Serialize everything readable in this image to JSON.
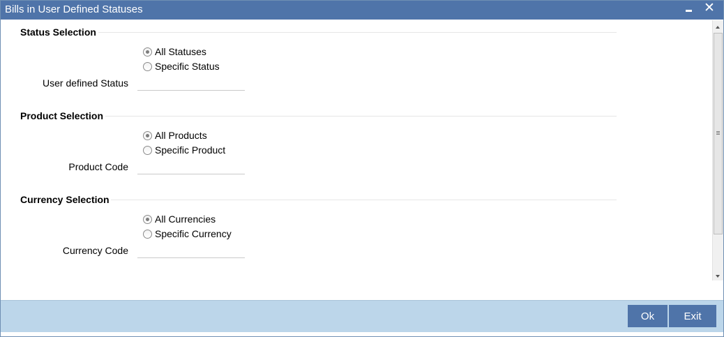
{
  "window": {
    "title": "Bills in User Defined Statuses",
    "minimize_icon": "minimize-icon",
    "close_icon": "close-icon",
    "close_glyph": "✕"
  },
  "status_section": {
    "title": "Status Selection",
    "options": [
      {
        "label": "All Statuses",
        "checked": true
      },
      {
        "label": "Specific Status",
        "checked": false
      }
    ],
    "field_label": "User defined Status",
    "field_value": ""
  },
  "product_section": {
    "title": "Product Selection",
    "options": [
      {
        "label": "All Products",
        "checked": true
      },
      {
        "label": "Specific Product",
        "checked": false
      }
    ],
    "field_label": "Product Code",
    "field_value": ""
  },
  "currency_section": {
    "title": "Currency Selection",
    "options": [
      {
        "label": "All Currencies",
        "checked": true
      },
      {
        "label": "Specific Currency",
        "checked": false
      }
    ],
    "field_label": "Currency Code",
    "field_value": ""
  },
  "footer": {
    "ok_label": "Ok",
    "exit_label": "Exit"
  },
  "colors": {
    "titlebar": "#4f74a9",
    "footer": "#bcd6ea",
    "button": "#4f74a9"
  }
}
